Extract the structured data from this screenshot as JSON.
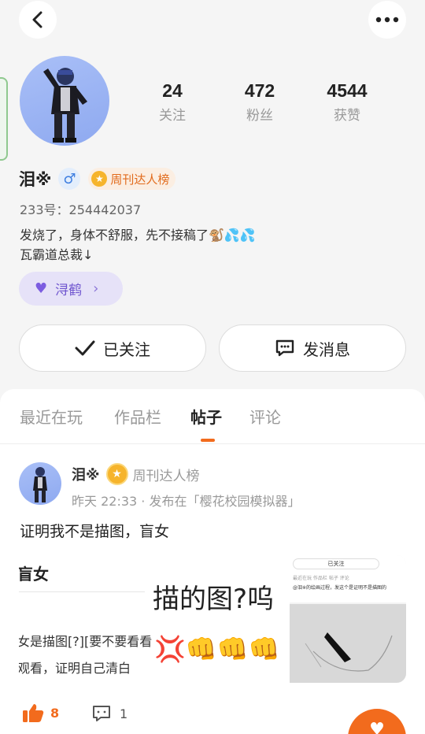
{
  "profile": {
    "nickname": "泪※",
    "gender_symbol": "♂",
    "rank_badge": "周刊达人榜",
    "uid": "233号：254442037",
    "bio_line1": "发烧了，身体不舒服，先不接稿了🐒💦💦",
    "bio_line2": "瓦霸道总裁↓",
    "guild": "浔鹤"
  },
  "stats": [
    {
      "value": "24",
      "label": "关注"
    },
    {
      "value": "472",
      "label": "粉丝"
    },
    {
      "value": "4544",
      "label": "获赞"
    }
  ],
  "actions": {
    "follow_label": "已关注",
    "message_label": "发消息"
  },
  "tabs": [
    "最近在玩",
    "作品栏",
    "帖子",
    "评论"
  ],
  "active_tab": "帖子",
  "post": {
    "author": "泪※",
    "rank_badge": "周刊达人榜",
    "meta": "昨天 22:33 · 发布在「樱花校园模拟器」",
    "title": "证明我不是描图，盲女",
    "image": {
      "left_title": "盲女",
      "left_line1": "女是描图[?][要不要看看",
      "left_line2": "观看，证明自己清白",
      "caption": "描的图?呜",
      "emoji": "💢👊👊👊",
      "shot_follow": "已关注",
      "shot_tabs": "最近在玩   作品栏   帖子   评论",
      "shot_post": "@泪※的绘画过程，发这个是证明不是描图的"
    },
    "likes": "8",
    "comments": "1"
  },
  "colors": {
    "accent": "#f26b1d",
    "guild": "#6f55cf",
    "gender": "#3f7fe0"
  }
}
